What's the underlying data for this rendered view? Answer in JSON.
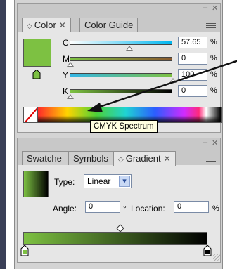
{
  "color_panel": {
    "tabs": [
      {
        "label": "Color",
        "active": true,
        "closable": true
      },
      {
        "label": "Color Guide",
        "active": false,
        "closable": false
      }
    ],
    "fill_color": "#7dc142",
    "channels": [
      {
        "letter": "C",
        "value": "57.65",
        "unit": "%",
        "level": 0.5765,
        "gradient": [
          "#ffffff",
          "#00b6ef"
        ]
      },
      {
        "letter": "M",
        "value": "0",
        "unit": "%",
        "level": 0.0,
        "gradient": [
          "#7dc142",
          "#8a5a2e"
        ]
      },
      {
        "letter": "Y",
        "value": "100",
        "unit": "%",
        "level": 1.0,
        "gradient": [
          "#33b5e5",
          "#7dc142"
        ]
      },
      {
        "letter": "K",
        "value": "0",
        "unit": "%",
        "level": 0.0,
        "gradient": [
          "#7dc142",
          "#000000"
        ]
      }
    ],
    "spectrum_tooltip": "CMYK Spectrum"
  },
  "gradient_panel": {
    "tabs": [
      {
        "label": "Swatche",
        "active": false,
        "closable": false
      },
      {
        "label": "Symbols",
        "active": false,
        "closable": false
      },
      {
        "label": "Gradient",
        "active": true,
        "closable": true
      }
    ],
    "type_label": "Type:",
    "type_value": "Linear",
    "angle_label": "Angle:",
    "angle_value": "0",
    "angle_unit": "°",
    "location_label": "Location:",
    "location_value": "0",
    "location_unit": "%",
    "gradient_start": "#7dc142",
    "gradient_end": "#000000"
  },
  "icons": {
    "close": "✕",
    "minimize": "–",
    "tab_diamond": "◇",
    "dropdown": "▾"
  }
}
